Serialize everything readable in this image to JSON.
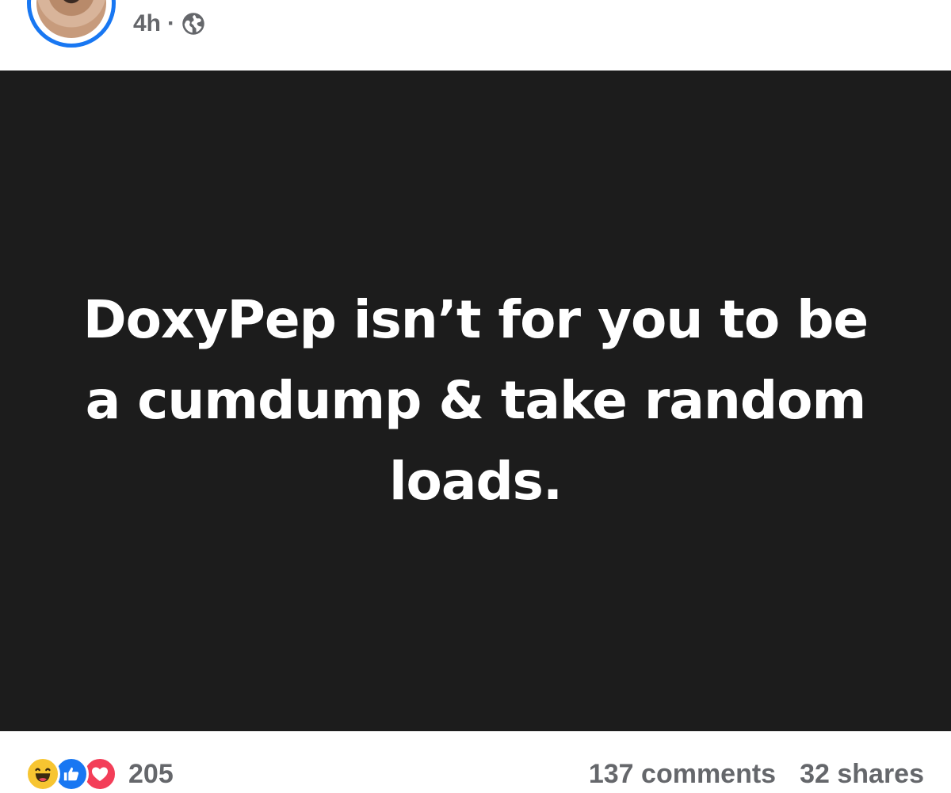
{
  "post": {
    "time": "4h",
    "separator": "·",
    "privacy_icon": "globe-icon",
    "text": "DoxyPep isn’t for you to be a cumdump & take random loads."
  },
  "reactions": {
    "icons": [
      "haha-reaction-icon",
      "like-reaction-icon",
      "love-reaction-icon"
    ],
    "count": "205"
  },
  "stats": {
    "comments": "137 comments",
    "shares": "32 shares"
  },
  "colors": {
    "accent": "#1877f2",
    "image_background": "#1c1c1c",
    "meta_text": "#65676b",
    "haha": "#f7c531",
    "like": "#1877f2",
    "love": "#f33e58"
  }
}
